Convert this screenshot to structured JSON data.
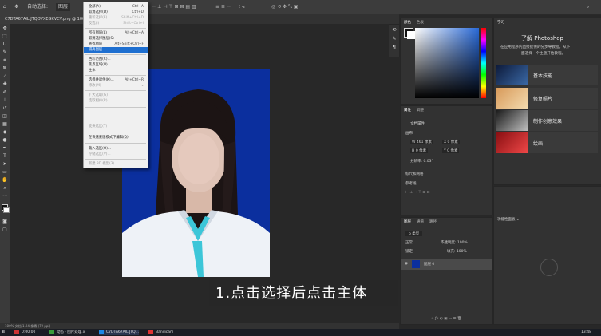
{
  "topbar": {
    "items": [
      "✥",
      "自动选择:",
      "图层",
      "显示变换控件"
    ]
  },
  "document_tab": "C7DTA67AIL.JTQOVXEGKVCV.png @ 100% (RGB/8)",
  "menu": {
    "items": [
      {
        "label": "全部(A)",
        "shortcut": "Ctrl+A",
        "state": "normal"
      },
      {
        "label": "取消选择(D)",
        "shortcut": "Ctrl+D",
        "state": "normal"
      },
      {
        "label": "重新选择(E)",
        "shortcut": "Shift+Ctrl+D",
        "state": "disabled"
      },
      {
        "label": "反选(I)",
        "shortcut": "Shift+Ctrl+I",
        "state": "disabled"
      },
      {
        "label": "所有图层(L)",
        "shortcut": "Alt+Ctrl+A",
        "state": "normal"
      },
      {
        "label": "取消选择图层(S)",
        "shortcut": "",
        "state": "normal"
      },
      {
        "label": "查找图层",
        "shortcut": "Alt+Shift+Ctrl+F",
        "state": "normal"
      },
      {
        "label": "隔离图层",
        "shortcut": "",
        "state": "highlighted"
      },
      {
        "label": "色彩范围(C)...",
        "shortcut": "",
        "state": "normal"
      },
      {
        "label": "焦点区域(U)...",
        "shortcut": "",
        "state": "normal"
      },
      {
        "label": "主体",
        "shortcut": "",
        "state": "normal"
      },
      {
        "label": "选择并遮住(K)...",
        "shortcut": "Alt+Ctrl+R",
        "state": "normal"
      },
      {
        "label": "修改(M)",
        "shortcut": "▸",
        "state": "disabled"
      },
      {
        "label": "扩大选取(G)",
        "shortcut": "",
        "state": "disabled"
      },
      {
        "label": "选取相似(R)",
        "shortcut": "",
        "state": "disabled"
      },
      {
        "label": "变换选区(T)",
        "shortcut": "",
        "state": "disabled"
      },
      {
        "label": "在快速蒙版模式下编辑(Q)",
        "shortcut": "",
        "state": "normal"
      },
      {
        "label": "载入选区(O)...",
        "shortcut": "",
        "state": "normal"
      },
      {
        "label": "存储选区(V)...",
        "shortcut": "",
        "state": "disabled"
      },
      {
        "label": "新建 3D 模型(3)",
        "shortcut": "",
        "state": "disabled"
      }
    ]
  },
  "caption": "1.点击选择后点击主体",
  "panels": {
    "color_tabs": [
      "颜色",
      "色板"
    ],
    "properties_tabs": [
      "属性",
      "调整"
    ],
    "properties_doc": "文档属性",
    "canvas_section": "画布",
    "canvas_w": "W  461 像素",
    "canvas_h": "H  0 像素",
    "canvas_x": "X  0 像素",
    "canvas_y": "Y  0 像素",
    "resolution": "分辨率: 0.03° ",
    "rulers_section": "标尺和网格",
    "guides_label": "参考线:",
    "layers_tabs": [
      "图层",
      "通道",
      "路径"
    ],
    "layers_kind": "ρ 类型",
    "blend_mode": "正常",
    "opacity": "不透明度: 100%",
    "lock_label": "锁定:",
    "fill": "填充: 100%",
    "layer_name": "图层 0",
    "learn_tab": "学习",
    "learn_title": "了解 Photoshop",
    "learn_sub1": "在应用程序内直接提供的分步导教程。从下",
    "learn_sub2": "面选择一个主题开始教程。",
    "learn_items": [
      "基本技能",
      "修复照片",
      "制作创意效果",
      "绘画"
    ],
    "libraries_label": "功能性面板 ⌄"
  },
  "status": "100%    文档:1.94 像素 (72 ppi)",
  "taskbar": {
    "items": [
      "0:00:00",
      "动态 · 图片处理.x",
      "C7DTA67AIL.JTQ...",
      "Bandicam"
    ],
    "clock": "13:48"
  },
  "colors": {
    "photo_bg": "#0b2f9e",
    "menu_highlight": "#1e6fd0",
    "ui_dark": "#323232"
  }
}
